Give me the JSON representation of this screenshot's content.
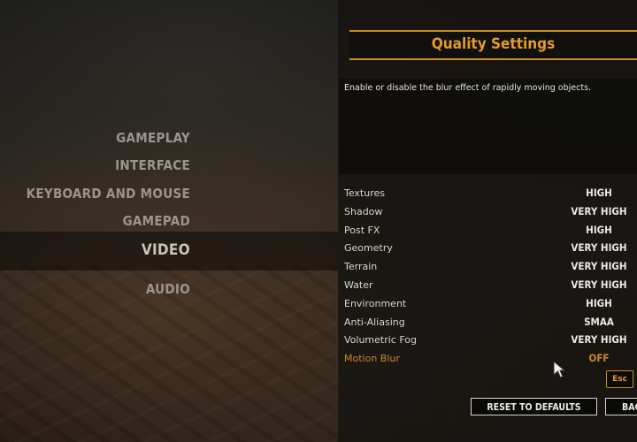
{
  "menu": {
    "items": [
      {
        "label": "GAMEPLAY"
      },
      {
        "label": "INTERFACE"
      },
      {
        "label": "KEYBOARD AND MOUSE"
      },
      {
        "label": "GAMEPAD"
      },
      {
        "label": "VIDEO"
      },
      {
        "label": "AUDIO"
      }
    ],
    "active": "VIDEO"
  },
  "panel": {
    "title": "Quality Settings",
    "description": "Enable or disable the blur effect of rapidly moving objects."
  },
  "settings": [
    {
      "label": "Textures",
      "value": "HIGH"
    },
    {
      "label": "Shadow",
      "value": "VERY HIGH"
    },
    {
      "label": "Post FX",
      "value": "HIGH"
    },
    {
      "label": "Geometry",
      "value": "VERY HIGH"
    },
    {
      "label": "Terrain",
      "value": "VERY HIGH"
    },
    {
      "label": "Water",
      "value": "VERY HIGH"
    },
    {
      "label": "Environment",
      "value": "HIGH"
    },
    {
      "label": "Anti-Aliasing",
      "value": "SMAA"
    },
    {
      "label": "Volumetric Fog",
      "value": "VERY HIGH"
    },
    {
      "label": "Motion Blur",
      "value": "OFF"
    }
  ],
  "selected_setting": "Motion Blur",
  "buttons": {
    "esc": "Esc",
    "reset": "RESET TO DEFAULTS",
    "back": "BACK"
  },
  "colors": {
    "accent": "#c98a2a",
    "title": "#e39a2e",
    "menu_text": "#9a958e"
  }
}
